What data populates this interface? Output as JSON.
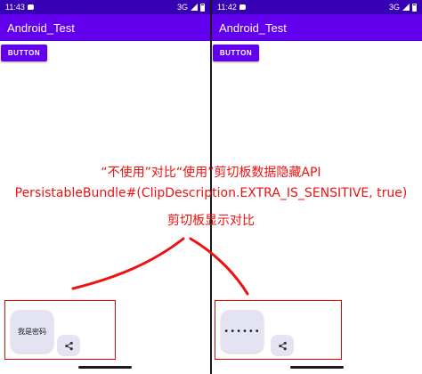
{
  "left_phone": {
    "status_time": "11:43",
    "status_network": "3G",
    "app_title": "Android_Test",
    "button_label": "BUTTON",
    "clipboard_text": "我是密码"
  },
  "right_phone": {
    "status_time": "11:42",
    "status_network": "3G",
    "app_title": "Android_Test",
    "button_label": "BUTTON",
    "clipboard_text": "••••••"
  },
  "annotation": {
    "line1": "“不使用”对比“使用”剪切板数据隐藏API",
    "line2": "PersistableBundle#(ClipDescription.EXTRA_IS_SENSITIVE, true)",
    "line3": "剪切板显示对比"
  },
  "colors": {
    "status_bar": "#3700b3",
    "app_bar": "#6200ee",
    "annotation": "#ee1111",
    "chip_background": "#e3e3f2"
  },
  "icons": {
    "share": "share-icon",
    "message": "message-icon",
    "signal": "signal-icon",
    "battery": "battery-icon"
  }
}
